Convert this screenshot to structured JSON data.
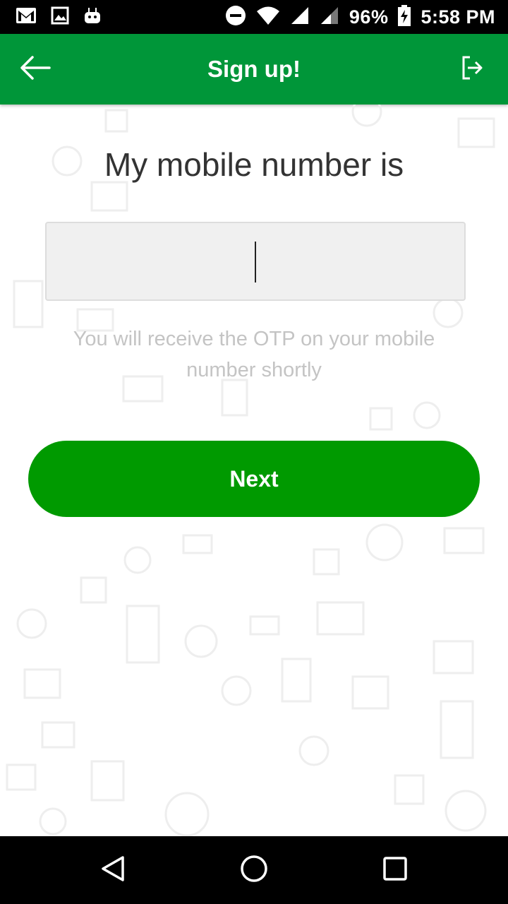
{
  "status_bar": {
    "battery": "96%",
    "time": "5:58 PM",
    "left_icons": [
      "gmail-icon",
      "image-icon",
      "android-icon"
    ],
    "right_icons": [
      "do-not-disturb-icon",
      "wifi-icon",
      "signal-icon",
      "signal-icon",
      "battery-charging-icon"
    ]
  },
  "app_bar": {
    "title": "Sign up!",
    "background_color": "#009639",
    "back_icon": "arrow-left-icon",
    "exit_icon": "logout-icon"
  },
  "main": {
    "heading": "My mobile number is",
    "phone_input": {
      "value": "",
      "placeholder": ""
    },
    "hint": "You will receive the OTP on your mobile number shortly",
    "next_label": "Next",
    "button_color": "#009a00"
  },
  "nav_bar": {
    "icons": [
      "back-triangle-icon",
      "home-circle-icon",
      "recents-square-icon"
    ]
  }
}
